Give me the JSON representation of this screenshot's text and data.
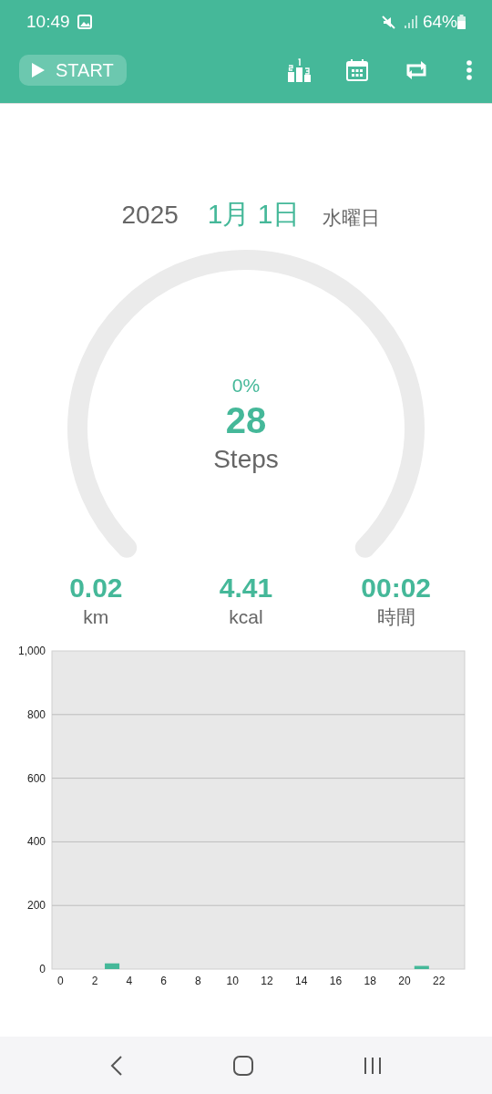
{
  "status_bar": {
    "time": "10:49",
    "battery": "64%"
  },
  "toolbar": {
    "start_label": "START"
  },
  "date": {
    "year": "2025",
    "day": "1月 1日",
    "weekday": "水曜日"
  },
  "gauge": {
    "percent": "0%",
    "steps": "28",
    "unit": "Steps"
  },
  "stats": [
    {
      "value": "0.02",
      "unit": "km"
    },
    {
      "value": "4.41",
      "unit": "kcal"
    },
    {
      "value": "00:02",
      "unit": "時間"
    }
  ],
  "chart_data": {
    "type": "bar",
    "x": [
      0,
      1,
      2,
      3,
      4,
      5,
      6,
      7,
      8,
      9,
      10,
      11,
      12,
      13,
      14,
      15,
      16,
      17,
      18,
      19,
      20,
      21,
      22,
      23
    ],
    "grid": true,
    "series": [
      {
        "color": "#45b899",
        "values": [
          0,
          0,
          0,
          18,
          0,
          0,
          0,
          0,
          0,
          0,
          0,
          0,
          0,
          0,
          0,
          0,
          0,
          0,
          0,
          0,
          0,
          10,
          0,
          0
        ]
      }
    ],
    "xlim": [
      -0.5,
      23.5
    ],
    "ylim": [
      0,
      1000
    ],
    "xticks": [
      0,
      2,
      4,
      6,
      8,
      10,
      12,
      14,
      16,
      18,
      20,
      22
    ],
    "yticks": [
      0,
      200,
      400,
      600,
      800,
      {
        "value": 1000,
        "label": "1,000"
      }
    ]
  }
}
